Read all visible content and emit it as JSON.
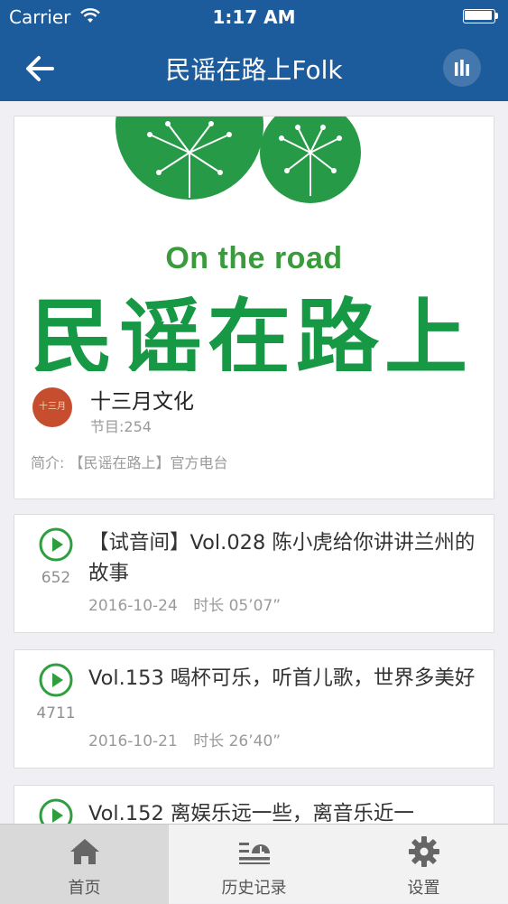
{
  "status_bar": {
    "carrier": "Carrier",
    "time": "1:17 AM"
  },
  "nav": {
    "title": "民谣在路上Folk",
    "back_icon": "back-arrow-icon",
    "player_icon": "equalizer-icon"
  },
  "album": {
    "banner_subtitle": "On the road",
    "banner_title": "民谣在路上",
    "publisher_logo_text": "十三月",
    "publisher": "十三月文化",
    "program_count": "节目:254",
    "intro": "简介: 【民谣在路上】官方电台"
  },
  "episodes": [
    {
      "title": "【试音间】Vol.028 陈小虎给你讲讲兰州的故事",
      "plays": "652",
      "date": "2016-10-24",
      "duration": "时长 05’07”"
    },
    {
      "title": "Vol.153 喝杯可乐，听首儿歌，世界多美好",
      "plays": "4711",
      "date": "2016-10-21",
      "duration": "时长 26’40”"
    },
    {
      "title": "Vol.152 离娱乐远一些，离音乐近一",
      "plays": "",
      "date": "",
      "duration": ""
    }
  ],
  "tabbar": {
    "items": [
      {
        "label": "首页",
        "icon": "home-icon",
        "active": true
      },
      {
        "label": "历史记录",
        "icon": "history-icon",
        "active": false
      },
      {
        "label": "设置",
        "icon": "gear-icon",
        "active": false
      }
    ]
  },
  "colors": {
    "header": "#1c5b9c",
    "accent_green": "#2e9e3e",
    "background": "#efeff4"
  }
}
